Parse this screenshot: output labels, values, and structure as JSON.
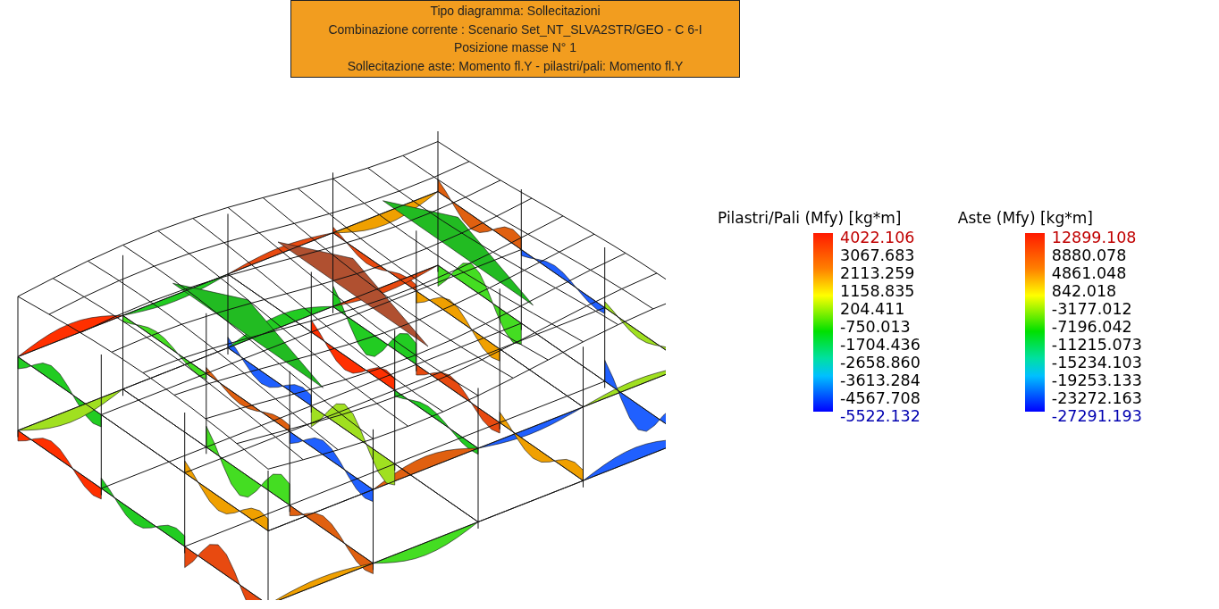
{
  "info_box": {
    "lines": [
      "Tipo diagramma: Sollecitazioni",
      "Combinazione corrente : Scenario Set_NT_SLVA2STR/GEO - C 6-I",
      "Posizione masse N° 1",
      "Sollecitazione aste: Momento fl.Y - pilastri/pali: Momento fl.Y"
    ]
  },
  "legends": [
    {
      "title": "Pilastri/Pali (Mfy) [kg*m]",
      "values": [
        {
          "text": "4022.106",
          "kind": "max"
        },
        {
          "text": "3067.683",
          "kind": "mid"
        },
        {
          "text": "2113.259",
          "kind": "mid"
        },
        {
          "text": "1158.835",
          "kind": "mid"
        },
        {
          "text": "204.411",
          "kind": "mid"
        },
        {
          "text": "-750.013",
          "kind": "mid"
        },
        {
          "text": "-1704.436",
          "kind": "mid"
        },
        {
          "text": "-2658.860",
          "kind": "mid"
        },
        {
          "text": "-3613.284",
          "kind": "mid"
        },
        {
          "text": "-4567.708",
          "kind": "mid"
        },
        {
          "text": "-5522.132",
          "kind": "min"
        }
      ]
    },
    {
      "title": "Aste (Mfy) [kg*m]",
      "values": [
        {
          "text": "12899.108",
          "kind": "max"
        },
        {
          "text": "8880.078",
          "kind": "mid"
        },
        {
          "text": "4861.048",
          "kind": "mid"
        },
        {
          "text": "842.018",
          "kind": "mid"
        },
        {
          "text": "-3177.012",
          "kind": "mid"
        },
        {
          "text": "-7196.042",
          "kind": "mid"
        },
        {
          "text": "-11215.073",
          "kind": "mid"
        },
        {
          "text": "-15234.103",
          "kind": "mid"
        },
        {
          "text": "-19253.133",
          "kind": "mid"
        },
        {
          "text": "-23272.163",
          "kind": "mid"
        },
        {
          "text": "-27291.193",
          "kind": "min"
        }
      ]
    }
  ]
}
